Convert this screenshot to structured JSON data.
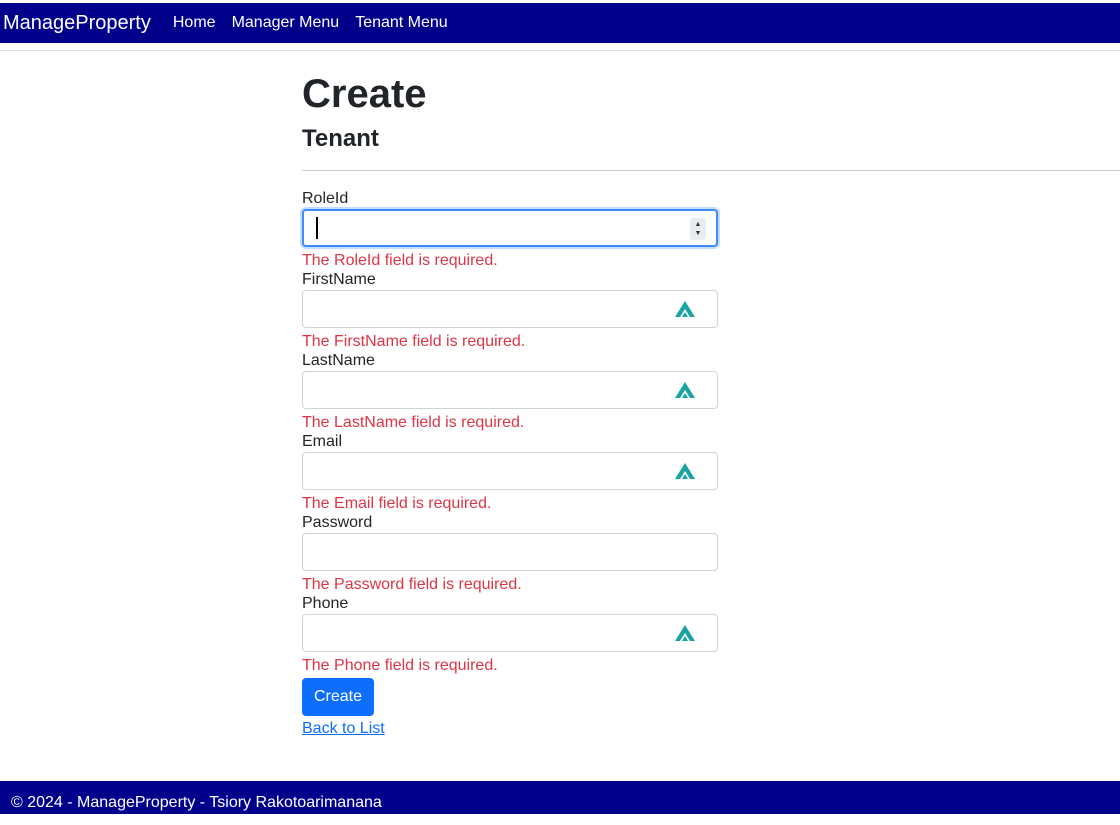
{
  "navbar": {
    "brand": "ManageProperty",
    "links": [
      "Home",
      "Manager Menu",
      "Tenant Menu"
    ]
  },
  "page": {
    "title": "Create",
    "subtitle": "Tenant"
  },
  "form": {
    "fields": [
      {
        "label": "RoleId",
        "value": "",
        "error": "The RoleId field is required."
      },
      {
        "label": "FirstName",
        "value": "",
        "error": "The FirstName field is required."
      },
      {
        "label": "LastName",
        "value": "",
        "error": "The LastName field is required."
      },
      {
        "label": "Email",
        "value": "",
        "error": "The Email field is required."
      },
      {
        "label": "Password",
        "value": "",
        "error": "The Password field is required."
      },
      {
        "label": "Phone",
        "value": "",
        "error": "The Phone field is required."
      }
    ],
    "submit_label": "Create",
    "back_label": "Back to List"
  },
  "footer": {
    "text": "© 2024 - ManageProperty - Tsiory Rakotoarimanana"
  },
  "colors": {
    "navbar_bg": "#00008b",
    "error": "#dc3545",
    "primary": "#0d6efd",
    "extension_icon": "#1aa3a3"
  },
  "icons": {
    "number_spinner": "spinner-arrows-icon",
    "password_manager": "nordpass-icon"
  }
}
